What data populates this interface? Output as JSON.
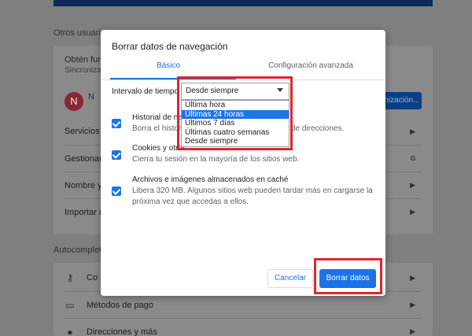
{
  "background": {
    "others_title": "Otros usuarios",
    "card_title": "Obtén func",
    "card_sub": "Sincroniza",
    "avatar_letter": "N",
    "avatar_name": "N",
    "sync_button": "Sincronización...",
    "rows": [
      "Servicios d",
      "Gestionar t",
      "Nombre y f",
      "Importar m"
    ],
    "autofill_title": "Autocomplet",
    "autofill_rows": [
      "Co",
      "Métodos de pago",
      "Direcciones y más"
    ]
  },
  "dialog": {
    "title": "Borrar datos de navegación",
    "tabs": {
      "basic": "Básico",
      "advanced": "Configuración avanzada"
    },
    "time_range": {
      "label": "Intervalo de tiempo",
      "value": "Desde siempre",
      "options": [
        "Última hora",
        "Últimas 24 horas",
        "Últimos 7 días",
        "Últimas cuatro semanas",
        "Desde siempre"
      ],
      "highlighted_option": "Últimas 24 horas"
    },
    "items": [
      {
        "title": "Historial de na",
        "desc_line1": "Borra el histori",
        "desc_line1_tail": "de direcciones."
      },
      {
        "title": "Cookies y otros",
        "desc_line1": "Cierra tu sesión en la mayoría de los sitios web."
      },
      {
        "title": "Archivos e imágenes almacenados en caché",
        "desc_line1": "Libera 320 MB. Algunos sitios web pueden tardar más en cargarse la",
        "desc_line2": "próxima vez que accedas a ellos."
      }
    ],
    "cancel_label": "Cancelar",
    "clear_label": "Borrar datos"
  },
  "colors": {
    "accent": "#1a73e8",
    "highlight": "#e0262a",
    "overlay": "#7f7f7f"
  }
}
